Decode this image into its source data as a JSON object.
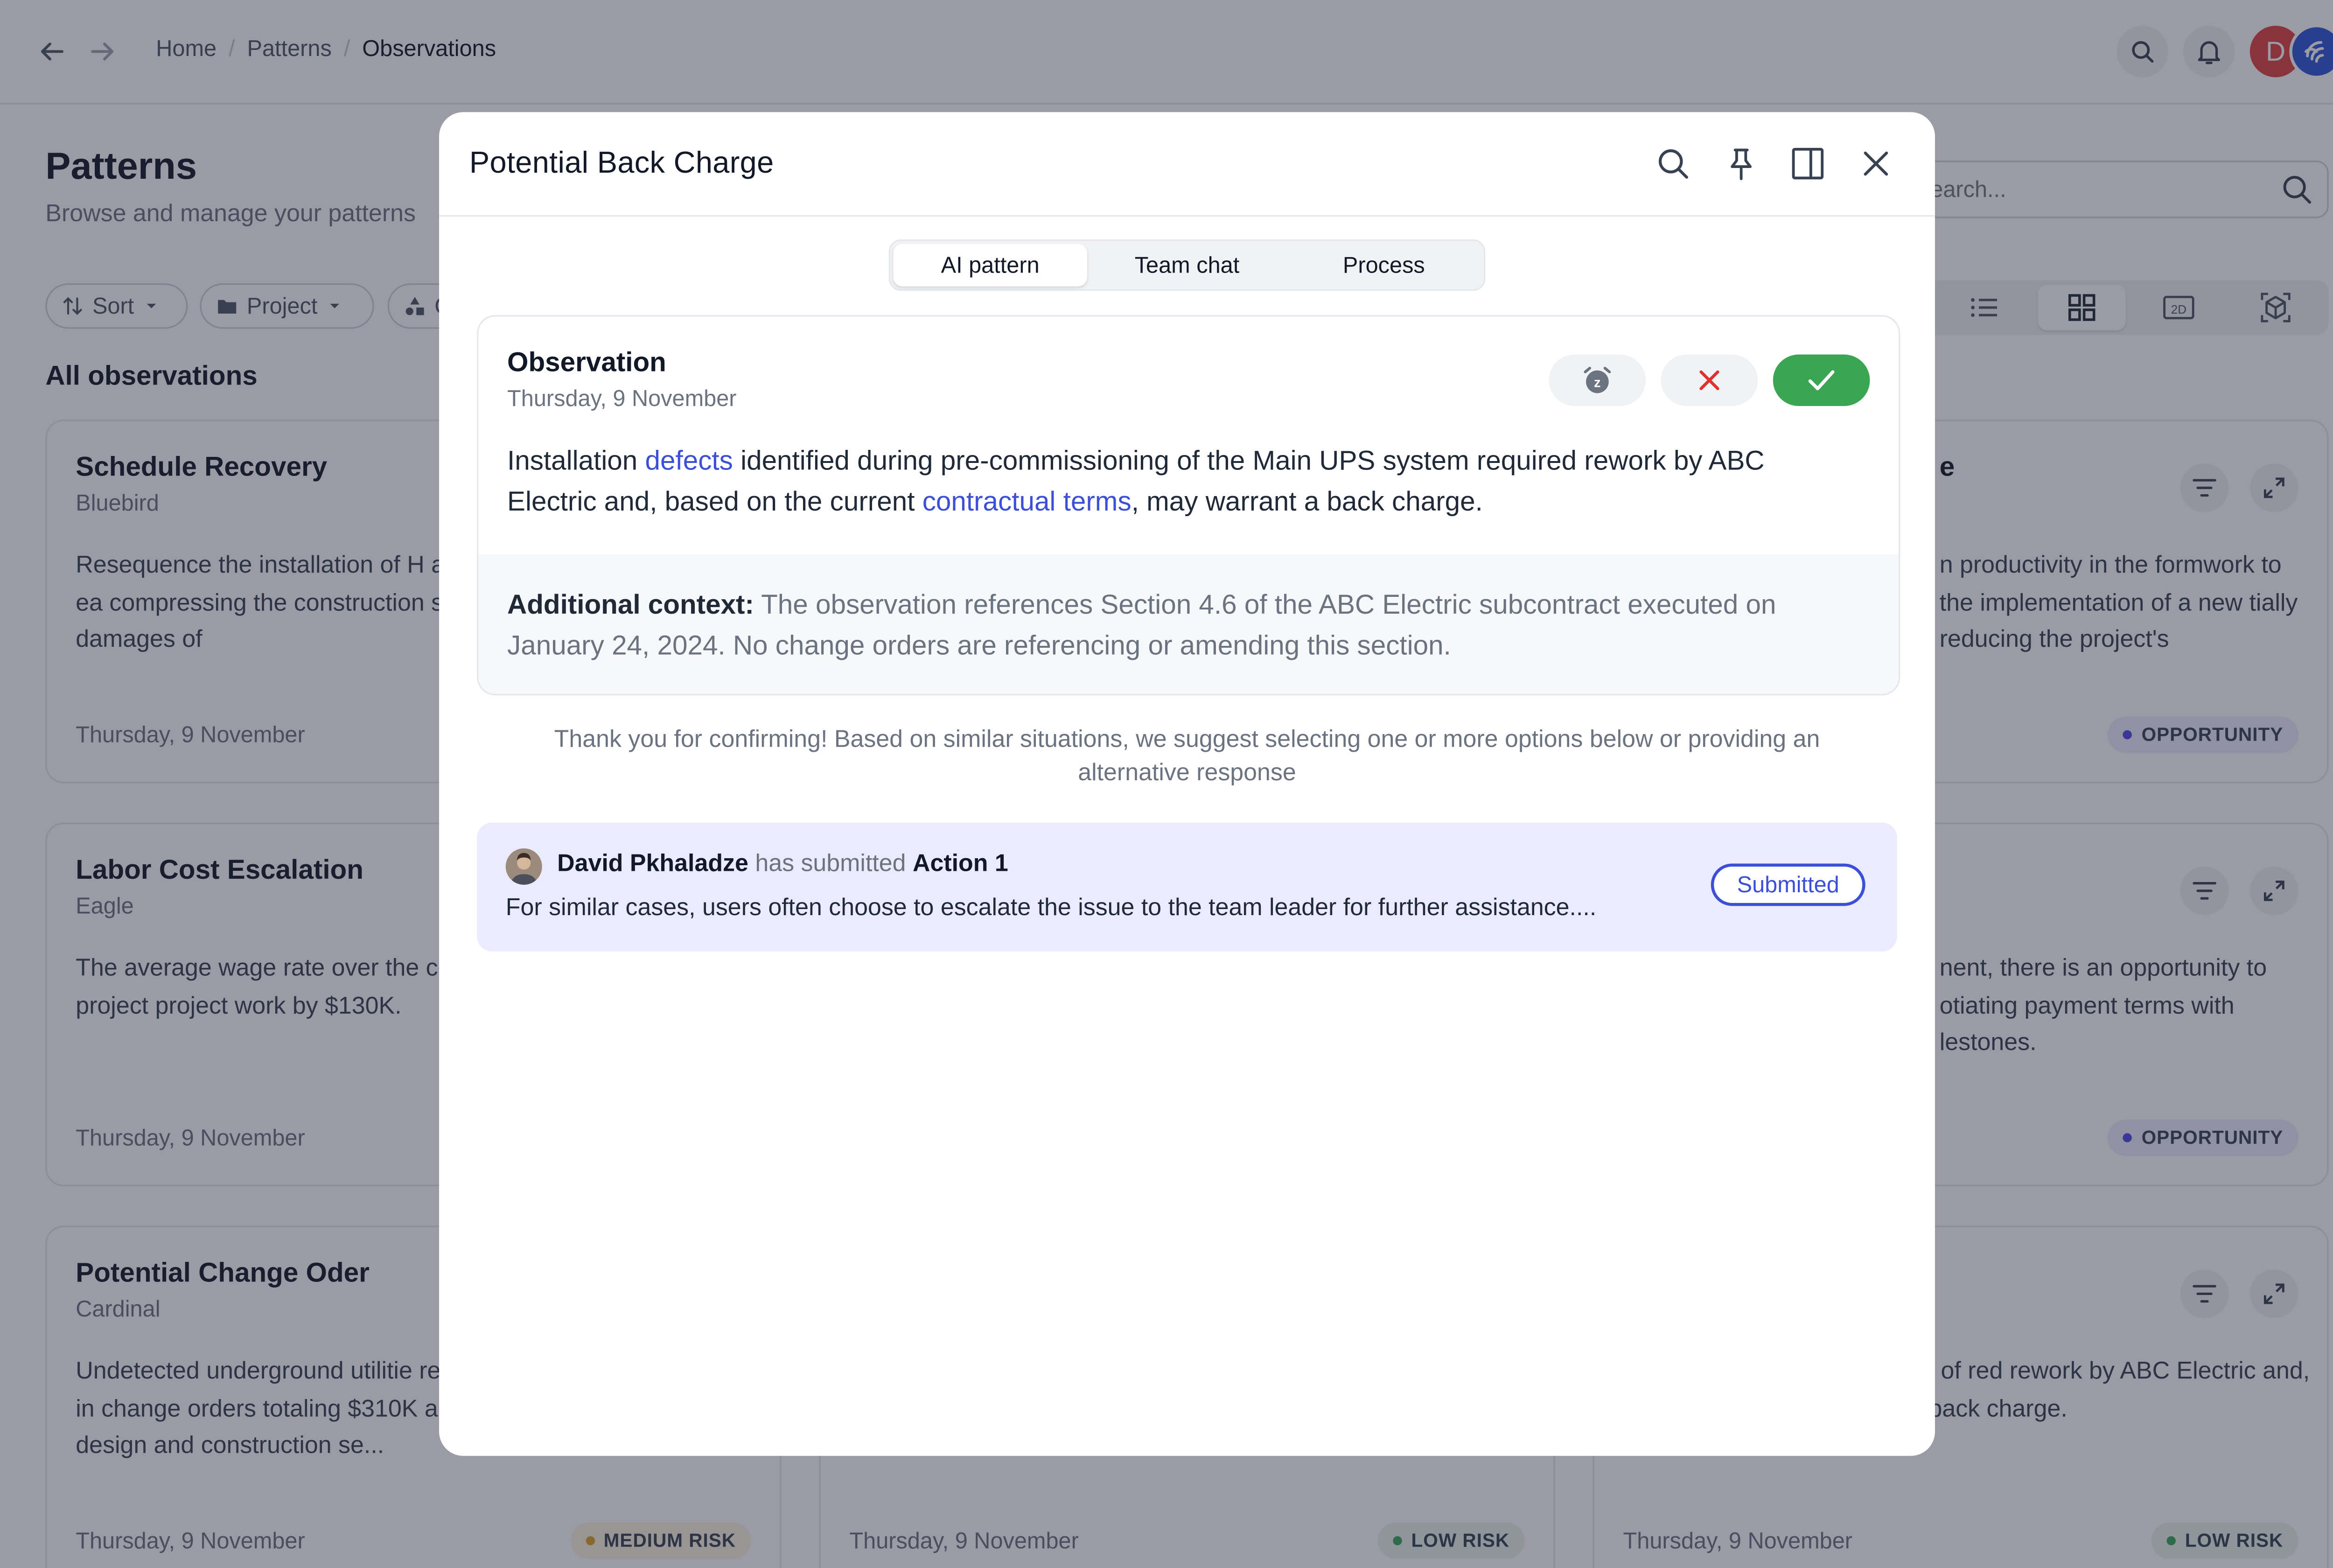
{
  "breadcrumb": [
    "Home",
    "Patterns",
    "Observations"
  ],
  "user_initial": "D",
  "page": {
    "title": "Patterns",
    "subtitle": "Browse and manage your patterns",
    "filters": [
      "Sort",
      "Project",
      "C"
    ],
    "search_placeholder": "Search...",
    "section_title": "All observations"
  },
  "cards": [
    {
      "title": "Schedule Recovery",
      "project": "Bluebird",
      "desc": "Resequence the installation of H advantage of an unexpected ea compressing the construction sc avoiding liquidated damages of",
      "date": "Thursday, 9 November",
      "badge": ""
    },
    {
      "title": "",
      "project": "",
      "desc": "n productivity in the formwork to the implementation of a new tially reducing the project's",
      "date": "",
      "badge": "OPPORTUNITY"
    },
    {
      "title": "Labor Cost Escalation",
      "project": "Eagle",
      "desc": "The average wage rate over the cost increases on similar project project work by $130K.",
      "date": "Thursday, 9 November",
      "badge": ""
    },
    {
      "title": "",
      "project": "",
      "desc": "nent, there is an opportunity to otiating payment terms with lestones.",
      "date": "",
      "badge": "OPPORTUNITY"
    },
    {
      "title": "Potential Change Oder",
      "project": "Cardinal",
      "desc": "Undetected underground utilitie report, may require re-routing d in change orders totaling $310K adjustment of the foundation design and construction se...",
      "date": "Thursday, 9 November",
      "badge": "MEDIUM RISK"
    },
    {
      "title": "",
      "project": "",
      "desc": "",
      "date": "Thursday, 9 November",
      "badge": "LOW RISK"
    },
    {
      "title": "",
      "project": "",
      "desc": "ed during pre-commissioning of red rework by ABC Electric and, actual terms, may warrant a back charge.",
      "date": "Thursday, 9 November",
      "badge": "LOW RISK"
    }
  ],
  "card6_partial_title": "e",
  "modal": {
    "title": "Potential Back Charge",
    "tabs": [
      "AI pattern",
      "Team chat",
      "Process"
    ],
    "observation": {
      "heading": "Observation",
      "date": "Thursday, 9 November",
      "text_1": "Installation ",
      "link_1": "defects",
      "text_2": " identified during pre-commissioning of the Main UPS system required rework by ABC Electric and, based on the current ",
      "link_2": "contractual terms",
      "text_3": ", may warrant a back charge.",
      "context_label": "Additional context:",
      "context_text": " The observation references Section 4.6 of the ABC Electric subcontract executed on January 24, 2024. No change orders are referencing or amending this section."
    },
    "thanks": "Thank you for confirming! Based on similar situations, we suggest selecting one or more options below or providing an alternative response",
    "submission": {
      "user": "David Pkhaladze",
      "verb": " has submitted ",
      "action": "Action 1",
      "text": "For similar cases, users often choose to escalate the issue to the team leader for further assistance....",
      "status": "Submitted"
    }
  },
  "colors": {
    "accent": "#3b4fd8",
    "accept": "#3aa552",
    "reject": "#e03131",
    "brand": "#2d55d8"
  }
}
